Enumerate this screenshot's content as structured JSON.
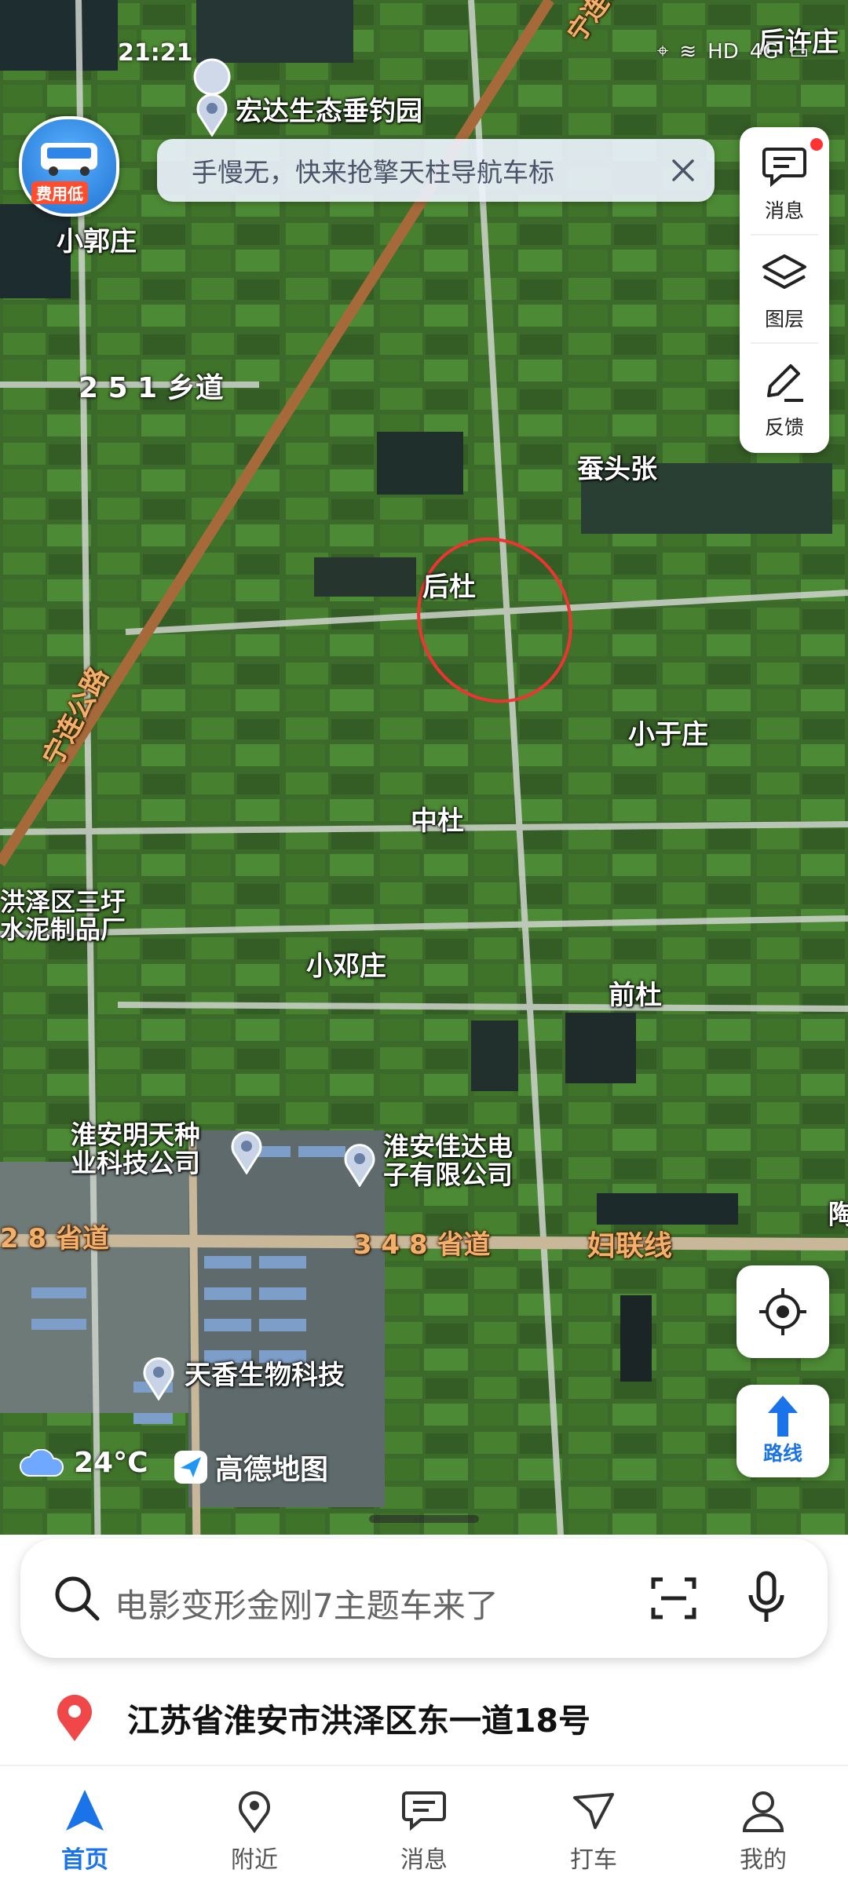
{
  "status_bar": {
    "time": "21:21",
    "net": "HD",
    "signal": "4G"
  },
  "promo_banner": {
    "text": "手慢无，快来抢擎天柱导航车标"
  },
  "bus_badge": {
    "label": "费用低"
  },
  "side_panel": {
    "messages": "消息",
    "layers": "图层",
    "feedback": "反馈"
  },
  "map": {
    "places": [
      "宏达生态垂钓园",
      "小郭庄",
      "后许庄",
      "蚕头张",
      "后杜",
      "小于庄",
      "中杜",
      "洪泽区三圩",
      "水泥制品厂",
      "小邓庄",
      "前杜",
      "淮安明天种",
      "业科技公司",
      "淮安佳达电",
      "子有限公司",
      "天香生物科技",
      "陶"
    ],
    "roads": [
      "2 5 1 乡道",
      "宁连公路",
      "宁连公路",
      "2 8 省道",
      "3 4 8 省道",
      "妇联线"
    ]
  },
  "weather": {
    "temp": "24°C"
  },
  "brand": {
    "name": "高德地图"
  },
  "route_button": {
    "label": "路线"
  },
  "search": {
    "placeholder": "电影变形金刚7主题车来了"
  },
  "address": {
    "text": "江苏省淮安市洪泽区东一道18号"
  },
  "tabs": [
    {
      "label": "首页",
      "active": true
    },
    {
      "label": "附近"
    },
    {
      "label": "消息"
    },
    {
      "label": "打车"
    },
    {
      "label": "我的"
    }
  ],
  "colors": {
    "accent": "#1a73e8",
    "road_label": "#f2b06a",
    "pin_red": "#f04848"
  }
}
